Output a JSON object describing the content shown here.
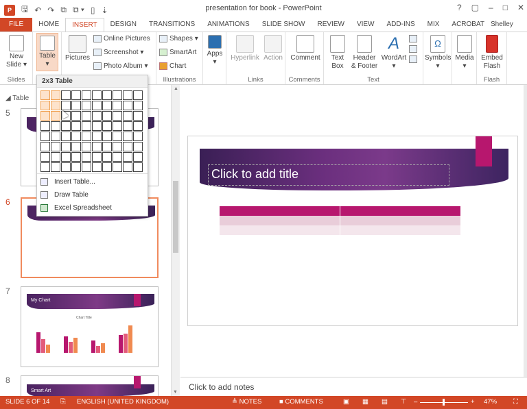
{
  "window": {
    "title": "presentation for book - PowerPoint",
    "help": "?",
    "controls": [
      "▢",
      "–",
      "□",
      "✕"
    ],
    "user": "Shelley Fi... ▾"
  },
  "qat": {
    "logo": "P",
    "save": "🖫",
    "undo": "↶",
    "redo": "↷",
    "start": "⧉",
    "more": "⧉ ▾",
    "new": "▯",
    "customize": "⇣"
  },
  "tabs": [
    "FILE",
    "HOME",
    "INSERT",
    "DESIGN",
    "TRANSITIONS",
    "ANIMATIONS",
    "SLIDE SHOW",
    "REVIEW",
    "VIEW",
    "ADD-INS",
    "MIX",
    "ACROBAT"
  ],
  "ribbon": {
    "slides": {
      "new": "New Slide ▾",
      "label": "Slides"
    },
    "tables": {
      "table": "Table ▾"
    },
    "images": {
      "pictures": "Pictures",
      "online": "Online Pictures",
      "screenshot": "Screenshot ▾",
      "album": "Photo Album ▾"
    },
    "illustrations": {
      "shapes": "Shapes ▾",
      "smartart": "SmartArt",
      "chart": "Chart",
      "label": "Illustrations"
    },
    "apps": {
      "apps": "Apps ▾"
    },
    "links": {
      "hyperlink": "Hyperlink",
      "action": "Action",
      "label": "Links"
    },
    "comments": {
      "comment": "Comment",
      "label": "Comments"
    },
    "text": {
      "textbox": "Text Box",
      "header": "Header & Footer",
      "wordart": "WordArt ▾",
      "label": "Text"
    },
    "symbols": {
      "symbols": "Symbols ▾"
    },
    "media": {
      "media": "Media ▾"
    },
    "flash": {
      "embed": "Embed Flash",
      "label": "Flash"
    }
  },
  "table_dropdown": {
    "header": "2x3 Table",
    "items": [
      "Insert Table...",
      "Draw Table",
      "Excel Spreadsheet"
    ]
  },
  "thumbs": {
    "section": "◢ Table",
    "slides": [
      {
        "num": "5"
      },
      {
        "num": "6"
      },
      {
        "num": "7",
        "title": "My Chart",
        "chart_title": "Chart Title"
      },
      {
        "num": "8",
        "title": "Smart Art"
      }
    ]
  },
  "slide": {
    "title_placeholder": "Click to add title"
  },
  "notes": {
    "placeholder": "Click to add notes"
  },
  "status": {
    "slide": "SLIDE 6 OF 14",
    "lang": "ENGLISH (UNITED KINGDOM)",
    "notes": "≜ NOTES",
    "comments": "■ COMMENTS",
    "zoom_minus": "–",
    "zoom_plus": "+",
    "zoom": "47%"
  },
  "colors": {
    "accent": "#d24726",
    "magenta": "#b7176e"
  }
}
